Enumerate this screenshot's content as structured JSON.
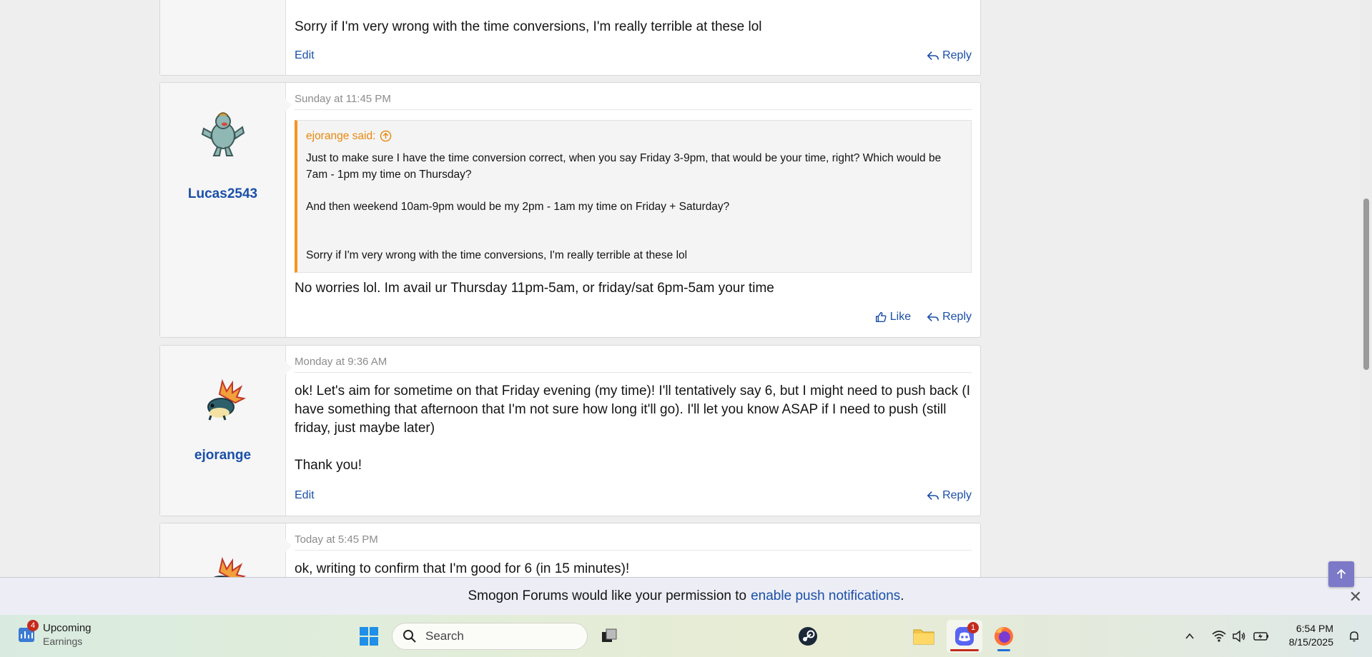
{
  "posts": [
    {
      "body": "Sorry if I'm very wrong with the time conversions, I'm really terrible at these lol",
      "actions": {
        "edit": "Edit",
        "reply": "Reply"
      }
    },
    {
      "username": "Lucas2543",
      "timestamp": "Sunday at 11:45 PM",
      "quote": {
        "author": "ejorange said:",
        "lines": [
          "Just to make sure I have the time conversion correct, when you say Friday 3-9pm, that would be your time, right? Which would be 7am - 1pm my time on Thursday?",
          "And then weekend 10am-9pm would be my 2pm - 1am my time on Friday + Saturday?",
          "Sorry if I'm very wrong with the time conversions, I'm really terrible at these lol"
        ]
      },
      "body": "No worries lol. Im avail ur Thursday 11pm-5am, or friday/sat 6pm-5am your time",
      "actions": {
        "like": "Like",
        "reply": "Reply"
      }
    },
    {
      "username": "ejorange",
      "timestamp": "Monday at 9:36 AM",
      "body": [
        "ok! Let's aim for sometime on that Friday evening (my time)! I'll tentatively say 6, but I might need to push back (I have something that afternoon that I'm not sure how long it'll go). I'll let you know ASAP if I need to push (still friday, just maybe later)",
        "Thank you!"
      ],
      "actions": {
        "edit": "Edit",
        "reply": "Reply"
      }
    },
    {
      "timestamp": "Today at 5:45 PM",
      "body": "ok, writing to confirm that I'm good for 6 (in 15 minutes)!"
    }
  ],
  "notification": {
    "text": "Smogon Forums would like your permission to",
    "link": "enable push notifications",
    "period": ".",
    "close": "✕"
  },
  "taskbar": {
    "widget": {
      "title": "Upcoming",
      "subtitle": "Earnings",
      "badge": "4"
    },
    "search_placeholder": "Search",
    "discord_badge": "1",
    "time": "6:54 PM",
    "date": "8/15/2025"
  },
  "colors": {
    "link_blue": "#1a4fa8",
    "quote_orange": "#f7941d",
    "scroll_button": "#7c79c8"
  }
}
